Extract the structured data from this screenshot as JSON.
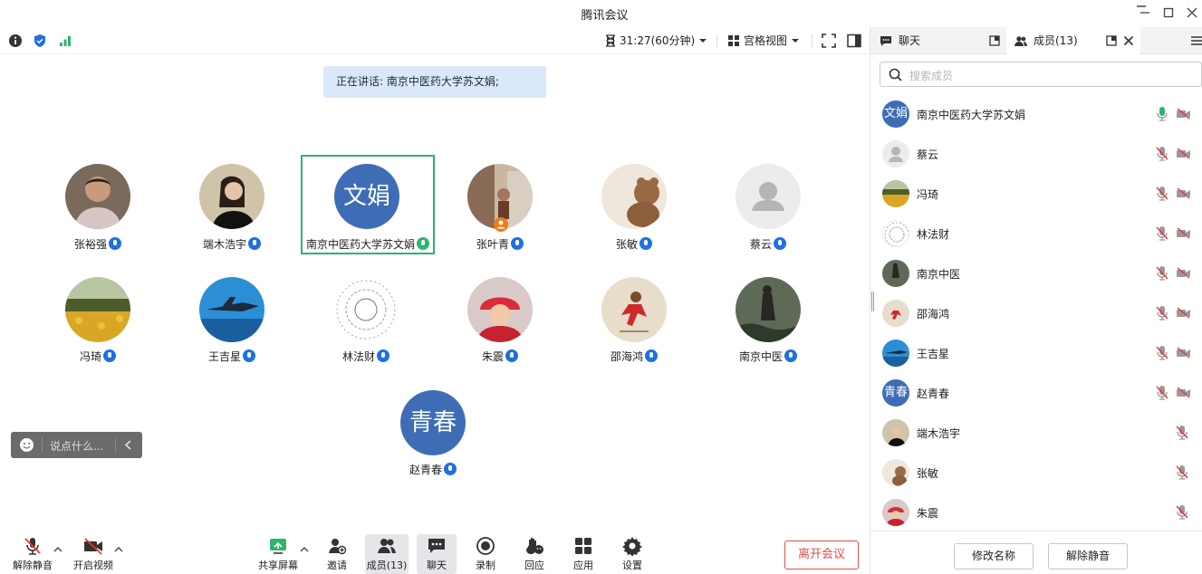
{
  "window": {
    "title": "腾讯会议"
  },
  "toolbar": {
    "timer": "31:27(60分钟)",
    "view_mode": "宫格视图"
  },
  "speaking": {
    "text": "正在讲话: 南京中医药大学苏文娟;"
  },
  "participants": [
    {
      "name": "张裕强"
    },
    {
      "name": "端木浩宇"
    },
    {
      "name": "南京中医药大学苏文娟",
      "avatar_text": "文娟"
    },
    {
      "name": "张叶青"
    },
    {
      "name": "张敏"
    },
    {
      "name": "蔡云"
    },
    {
      "name": "冯琦"
    },
    {
      "name": "王吉星"
    },
    {
      "name": "林法财"
    },
    {
      "name": "朱震"
    },
    {
      "name": "邵海鸿"
    },
    {
      "name": "南京中医"
    },
    {
      "name": "赵青春",
      "avatar_text": "青春"
    }
  ],
  "chat": {
    "placeholder": "说点什么..."
  },
  "bottombar": {
    "unmute": "解除静音",
    "start_video": "开启视频",
    "share": "共享屏幕",
    "invite": "邀请",
    "members": "成员(13)",
    "chat": "聊天",
    "record": "录制",
    "react": "回应",
    "apps": "应用",
    "settings": "设置",
    "leave": "离开会议"
  },
  "panel": {
    "tab_chat": "聊天",
    "tab_members": "成员(13)",
    "search_placeholder": "搜索成员",
    "members": [
      {
        "name": "南京中医药大学苏文娟",
        "avatar_text": "文娟"
      },
      {
        "name": "蔡云"
      },
      {
        "name": "冯琦"
      },
      {
        "name": "林法财"
      },
      {
        "name": "南京中医"
      },
      {
        "name": "邵海鸿"
      },
      {
        "name": "王吉星"
      },
      {
        "name": "赵青春",
        "avatar_text": "青春"
      },
      {
        "name": "端木浩宇"
      },
      {
        "name": "张敏"
      },
      {
        "name": "朱震"
      }
    ],
    "rename": "修改名称",
    "unmute_all": "解除静音"
  },
  "colors": {
    "accent": "#1f6fe5",
    "active_border": "#2db56c",
    "leave": "#e34d4d",
    "avatar_blue": "#3f6db5"
  }
}
